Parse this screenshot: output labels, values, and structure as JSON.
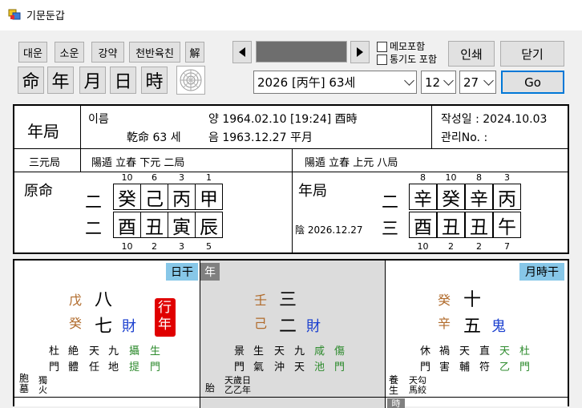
{
  "window": {
    "title": "기문둔갑"
  },
  "toolbar": {
    "row1": [
      "대운",
      "소운",
      "강약",
      "천반육친",
      "解"
    ],
    "row2": [
      "命",
      "年",
      "月",
      "日",
      "時"
    ],
    "memo_label": "메모포함",
    "tonggi_label": "통기도 포함",
    "print_label": "인쇄",
    "close_label": "닫기",
    "year_value": "2026 [丙午] 63세",
    "month_value": "12",
    "day_value": "27",
    "go_label": "Go"
  },
  "header": {
    "section": "年局",
    "name_label": "이름",
    "solar": "양 1964.02.10  [19:24]  酉時",
    "lunar": "음 1963.12.27  平月",
    "qianming": "乾命 63 세",
    "written_date": "작성일 : 2024.10.03",
    "manage_no": "관리No. :",
    "sanyuan": "三元局",
    "ju_left": "陽遁  立春  下元  二局",
    "ju_right": "陽遁  立春  上元  八局"
  },
  "yuanming": {
    "label": "原命",
    "row_labels": [
      "二",
      "二"
    ],
    "top_nums": [
      "10",
      "6",
      "3",
      "1"
    ],
    "stems": [
      "癸",
      "己",
      "丙",
      "甲"
    ],
    "branches": [
      "酉",
      "丑",
      "寅",
      "辰"
    ],
    "bottom_nums": [
      "10",
      "2",
      "3",
      "5"
    ]
  },
  "nianju": {
    "label": "年局",
    "row_labels": [
      "二",
      "三"
    ],
    "date": "陰 2026.12.27",
    "top_nums": [
      "8",
      "10",
      "8",
      "3"
    ],
    "stems": [
      "辛",
      "癸",
      "辛",
      "丙"
    ],
    "branches": [
      "酉",
      "丑",
      "丑",
      "午"
    ],
    "bottom_nums": [
      "10",
      "2",
      "2",
      "7"
    ]
  },
  "palaces": {
    "left": {
      "tag": "日干",
      "stem_top": "戊",
      "stem_bottom": "癸",
      "num_top": "八",
      "num_bottom": "七",
      "relation": "財",
      "badge": "行年",
      "row1": [
        "杜",
        "絶",
        "天",
        "九",
        "攝",
        "生"
      ],
      "row2": [
        "門",
        "體",
        "任",
        "地",
        "提",
        "門"
      ],
      "foot_a": "胞",
      "foot_b": "墓",
      "foot_c": "獨",
      "foot_d": "火"
    },
    "middle": {
      "tag": "年",
      "stem_top": "壬",
      "stem_bottom": "己",
      "num_top": "三",
      "num_bottom": "二",
      "relation": "財",
      "row1": [
        "景",
        "生",
        "天",
        "九",
        "咸",
        "傷"
      ],
      "row2": [
        "門",
        "氣",
        "沖",
        "天",
        "池",
        "門"
      ],
      "foot_a": "胎",
      "foot_b": "天歲日",
      "foot_c": "乙乙年"
    },
    "right": {
      "tag": "月時干",
      "stem_top": "癸",
      "stem_bottom": "辛",
      "num_top": "十",
      "num_bottom": "五",
      "relation": "鬼",
      "row1": [
        "休",
        "禍",
        "天",
        "直",
        "天",
        "杜"
      ],
      "row2": [
        "門",
        "害",
        "輔",
        "符",
        "乙",
        "門"
      ],
      "foot_a": "養",
      "foot_b": "生",
      "foot_c": "天勾",
      "foot_d": "馬絞"
    },
    "bottom_tag": "時"
  },
  "colors": {
    "tag_blue": "#87c7e8",
    "tag_gray": "#808080",
    "shade": "#dcdcdc",
    "badge_red": "#e00000"
  }
}
